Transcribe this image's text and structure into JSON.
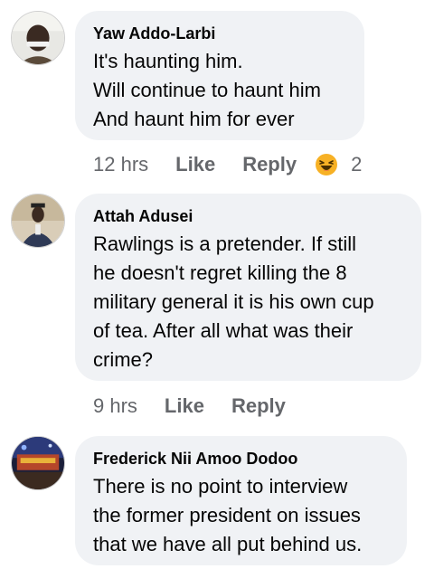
{
  "comments": [
    {
      "author": "Yaw Addo-Larbi",
      "text": "It's haunting him.\nWill continue to haunt him\nAnd haunt him for ever",
      "time": "12 hrs",
      "like_label": "Like",
      "reply_label": "Reply",
      "reaction": {
        "icon": "laughing-emoji-icon",
        "count": "2"
      }
    },
    {
      "author": "Attah Adusei",
      "text": "Rawlings is a pretender. If still\nhe doesn't regret killing the 8\nmilitary general it is his own cup\nof tea. After all what was their\ncrime?",
      "time": "9 hrs",
      "like_label": "Like",
      "reply_label": "Reply"
    },
    {
      "author": "Frederick Nii Amoo Dodoo",
      "text": "There is no point to interview\nthe former president on issues\nthat we have all put behind us."
    }
  ],
  "colors": {
    "bubble": "#f0f2f5",
    "secondary_text": "#65676b",
    "primary_text": "#050505",
    "emoji_yellow": "#f7b125"
  }
}
